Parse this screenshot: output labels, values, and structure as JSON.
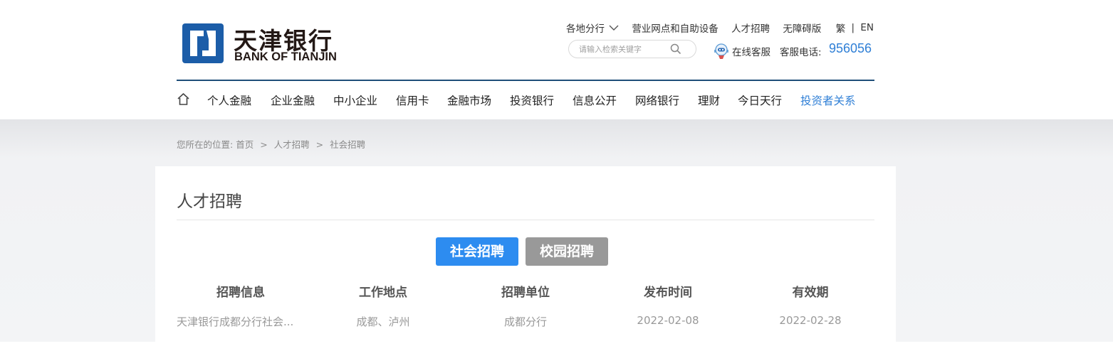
{
  "brand": {
    "name_cn": "天津银行",
    "name_en": "BANK OF TIANJIN",
    "colors": {
      "primary_blue": "#1c5da8",
      "accent_blue": "#2f7fd6",
      "nav_rule": "#1f4e79"
    }
  },
  "top_links": {
    "branches": "各地分行",
    "outlets": "营业网点和自助设备",
    "careers": "人才招聘",
    "accessible": "无障碍版",
    "lang_trad": "繁",
    "lang_sep": "|",
    "lang_en": "EN"
  },
  "search": {
    "placeholder": "请输入检索关键字",
    "icon": "search-icon"
  },
  "service": {
    "online_label": "在线客服",
    "hotline_label": "客服电话:",
    "hotline_number": "956056"
  },
  "nav": {
    "items": [
      "个人金融",
      "企业金融",
      "中小企业",
      "信用卡",
      "金融市场",
      "投资银行",
      "信息公开",
      "网络银行",
      "理财",
      "今日天行",
      "投资者关系"
    ],
    "active_index": 10
  },
  "breadcrumb": {
    "prefix": "您所在的位置:",
    "home": "首页",
    "sep": ">",
    "level1": "人才招聘",
    "level2": "社会招聘"
  },
  "page": {
    "title": "人才招聘",
    "tabs": [
      {
        "label": "社会招聘",
        "active": true,
        "color": "#2d8cf0"
      },
      {
        "label": "校园招聘",
        "active": false,
        "color": "#999999"
      }
    ],
    "table": {
      "headers": [
        "招聘信息",
        "工作地点",
        "招聘单位",
        "发布时间",
        "有效期"
      ],
      "rows": [
        [
          "天津银行成都分行社会...",
          "成都、泸州",
          "成都分行",
          "2022-02-08",
          "2022-02-28"
        ]
      ]
    }
  }
}
